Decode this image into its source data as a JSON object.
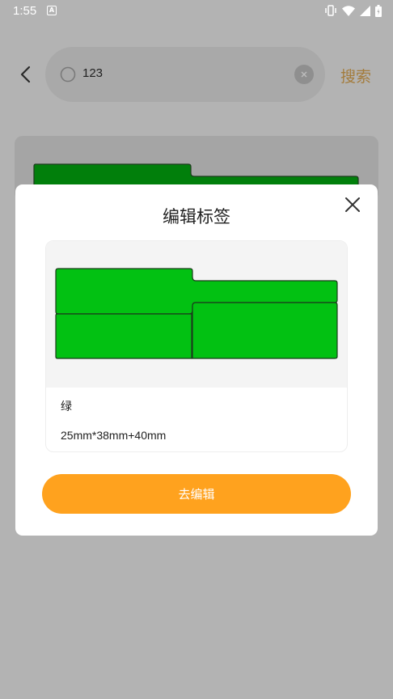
{
  "status_bar": {
    "time": "1:55",
    "app_icon": "A",
    "icons": [
      "vibrate-icon",
      "wifi-icon",
      "signal-icon",
      "battery-icon"
    ]
  },
  "search": {
    "query": "123",
    "action_label": "搜索",
    "icons": [
      "back-arrow-icon",
      "search-icon",
      "clear-icon"
    ]
  },
  "modal": {
    "title": "编辑标签",
    "close_icon": "close-icon",
    "label": {
      "name": "绿",
      "size": "25mm*38mm+40mm",
      "fill_color": "#02c112",
      "stroke_color": "#1c3a1c"
    },
    "edit_button_label": "去编辑"
  },
  "colors": {
    "accent": "#ffa21e",
    "search_action": "#a47c3c",
    "label_green_dimmed": "#017f0b"
  }
}
